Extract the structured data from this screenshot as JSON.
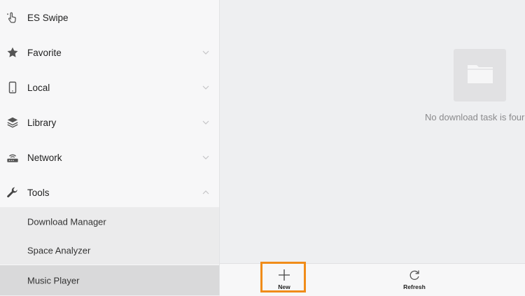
{
  "sidebar": {
    "items": [
      {
        "label": "ES Swipe",
        "icon": "swipe-hand-icon"
      },
      {
        "label": "Favorite",
        "icon": "star-icon"
      },
      {
        "label": "Local",
        "icon": "phone-icon"
      },
      {
        "label": "Library",
        "icon": "stack-layers-icon"
      },
      {
        "label": "Network",
        "icon": "network-router-icon"
      },
      {
        "label": "Tools",
        "icon": "wrench-icon"
      }
    ],
    "tools_submenu": [
      {
        "label": "Download Manager"
      },
      {
        "label": "Space Analyzer"
      },
      {
        "label": "Music Player",
        "selected": true
      }
    ]
  },
  "main": {
    "empty_icon": "folder-icon",
    "empty_message": "No download task is four"
  },
  "toolbar": {
    "new_label": "New",
    "refresh_label": "Refresh"
  },
  "colors": {
    "highlight": "#f08c1a",
    "sidebar_bg": "#f7f7f8",
    "selected_bg": "#d9d9da"
  }
}
